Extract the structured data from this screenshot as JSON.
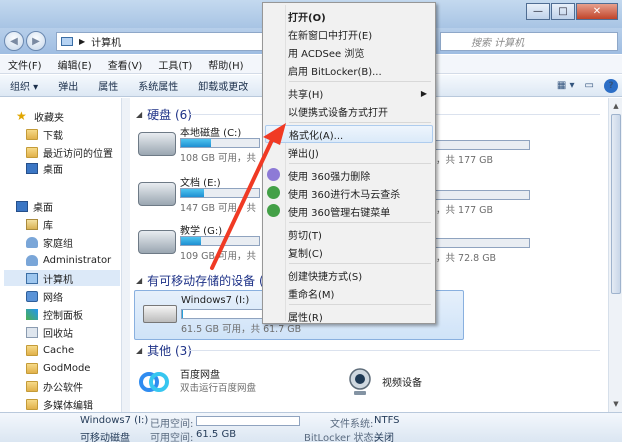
{
  "window": {
    "breadcrumb_sep": "▶",
    "breadcrumb": "计算机",
    "search_placeholder": "搜索 计算机"
  },
  "window_buttons": [
    "—",
    "□",
    "✕"
  ],
  "nav": {
    "back": "◀",
    "forward": "▶"
  },
  "menubar": [
    "文件(F)",
    "编辑(E)",
    "查看(V)",
    "工具(T)",
    "帮助(H)"
  ],
  "toolbar": {
    "items": [
      "组织 ▾",
      "弹出",
      "属性",
      "系统属性",
      "卸载或更改"
    ],
    "view": "▦ ▾"
  },
  "sidebar": [
    {
      "label": "收藏夹",
      "icon": "star-icon",
      "cls": "star",
      "glyph": "★",
      "indent": 0
    },
    {
      "label": "下载",
      "icon": "folder-icon",
      "cls": "folder",
      "indent": 1
    },
    {
      "label": "最近访问的位置",
      "icon": "folder-icon",
      "cls": "folder",
      "indent": 1
    },
    {
      "label": "桌面",
      "icon": "desktop-icon",
      "cls": "desk",
      "indent": 1
    },
    {
      "label": "桌面",
      "icon": "desktop-icon",
      "cls": "desk",
      "indent": 0
    },
    {
      "label": "库",
      "icon": "library-icon",
      "cls": "lib",
      "indent": 1
    },
    {
      "label": "家庭组",
      "icon": "homegroup-icon",
      "cls": "user",
      "indent": 1
    },
    {
      "label": "Administrator",
      "icon": "user-icon",
      "cls": "user",
      "indent": 1
    },
    {
      "label": "计算机",
      "icon": "computer-icon",
      "cls": "pc",
      "indent": 1
    },
    {
      "label": "网络",
      "icon": "network-icon",
      "cls": "net",
      "indent": 1
    },
    {
      "label": "控制面板",
      "icon": "control-panel-icon",
      "cls": "ctrl",
      "indent": 1
    },
    {
      "label": "回收站",
      "icon": "recycle-bin-icon",
      "cls": "bin",
      "indent": 1
    },
    {
      "label": "Cache",
      "icon": "folder-icon",
      "cls": "folder",
      "indent": 1
    },
    {
      "label": "GodMode",
      "icon": "folder-icon",
      "cls": "folder",
      "indent": 1
    },
    {
      "label": "办公软件",
      "icon": "folder-icon",
      "cls": "folder",
      "indent": 1
    },
    {
      "label": "多媒体编辑",
      "icon": "folder-icon",
      "cls": "folder",
      "indent": 1
    }
  ],
  "groups": {
    "hdd": "硬盘 (6)",
    "removable": "有可移动存储的设备 (1",
    "other": "其他 (3)"
  },
  "drives": [
    {
      "name": "本地磁盘 (C:)",
      "free": "108 GB 可用，共",
      "fill": 0.39
    },
    {
      "name": "文档 (E:)",
      "free": "147 GB 可用，共",
      "fill": 0.3
    },
    {
      "name": "教学 (G:)",
      "free": "109 GB 可用，共",
      "fill": 0.25
    }
  ],
  "right_drives": [
    {
      "text": "，共 177 GB"
    },
    {
      "text": "，共 177 GB"
    },
    {
      "text": "，共 72.8 GB"
    }
  ],
  "usb": {
    "name": "Windows7 (I:)",
    "free": "61.5 GB 可用，共 61.7 GB",
    "fill": 0.01
  },
  "others": [
    {
      "name": "百度网盘",
      "sub": "双击运行百度网盘"
    },
    {
      "name": "视频设备",
      "sub": ""
    }
  ],
  "context_menu": [
    {
      "label": "打开(O)",
      "bold": true
    },
    {
      "label": "在新窗口中打开(E)"
    },
    {
      "label": "用 ACDSee 浏览"
    },
    {
      "label": "启用 BitLocker(B)..."
    },
    {
      "sep": true
    },
    {
      "label": "共享(H)",
      "submenu": "▶"
    },
    {
      "label": "以便携式设备方式打开"
    },
    {
      "sep": true
    },
    {
      "label": "格式化(A)...",
      "highlight": true
    },
    {
      "label": "弹出(J)"
    },
    {
      "sep": true
    },
    {
      "label": "使用 360强力删除",
      "icon": "#8d7ad6"
    },
    {
      "label": "使用 360进行木马云查杀",
      "icon": "#43a047"
    },
    {
      "label": "使用 360管理右键菜单",
      "icon": "#43a047"
    },
    {
      "sep": true
    },
    {
      "label": "剪切(T)"
    },
    {
      "label": "复制(C)"
    },
    {
      "sep": true
    },
    {
      "label": "创建快捷方式(S)"
    },
    {
      "label": "重命名(M)"
    },
    {
      "sep": true
    },
    {
      "label": "属性(R)"
    }
  ],
  "status": {
    "drive_name": "Windows7 (I:)",
    "used_label": "已用空间:",
    "free_label": "可用空间:",
    "free_value": "61.5 GB",
    "type": "可移动磁盘",
    "fs_label": "文件系统:",
    "fs_value": "NTFS",
    "bl_label": "BitLocker 状态:",
    "bl_value": "关闭"
  },
  "colors": {
    "arrow": "#f03a24"
  }
}
